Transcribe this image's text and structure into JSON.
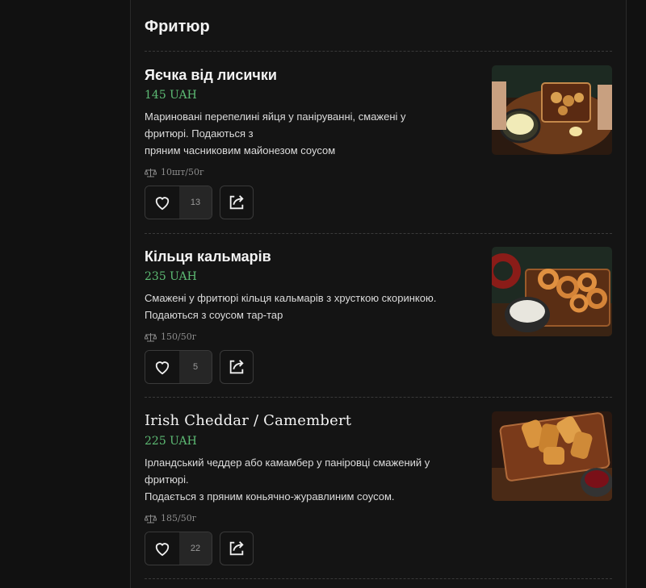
{
  "section": {
    "title": "Фритюр"
  },
  "items": [
    {
      "name": "Яєчка від лисички",
      "price": "145 UAH",
      "desc": [
        "Мариновані перепелині яйця у паніруванні, смажені у",
        "фритюрі. Подаються з",
        "пряним часниковим майонезом соусом"
      ],
      "weight": "10шт/50г",
      "likes": "13"
    },
    {
      "name": "Кільця кальмарів",
      "price": "235 UAH",
      "desc": [
        "Смажені у фритюрі кільця кальмарів з хрусткою скоринкою.",
        "Подаються з соусом тар-тар"
      ],
      "weight": "150/50г",
      "likes": "5"
    },
    {
      "name": "Irish Cheddar / Camembert",
      "price": "225 UAH",
      "desc": [
        "Ірландський чеддер або камамбер у паніровці смажений у",
        "фритюрі.",
        "Подається з пряним коньячно-журавлиним соусом."
      ],
      "weight": "185/50г",
      "likes": "22"
    }
  ],
  "icons": {
    "like": "heart-icon",
    "share": "share-icon",
    "weight": "scales-icon"
  },
  "colors": {
    "price": "#5dbb74",
    "background": "#111111"
  }
}
